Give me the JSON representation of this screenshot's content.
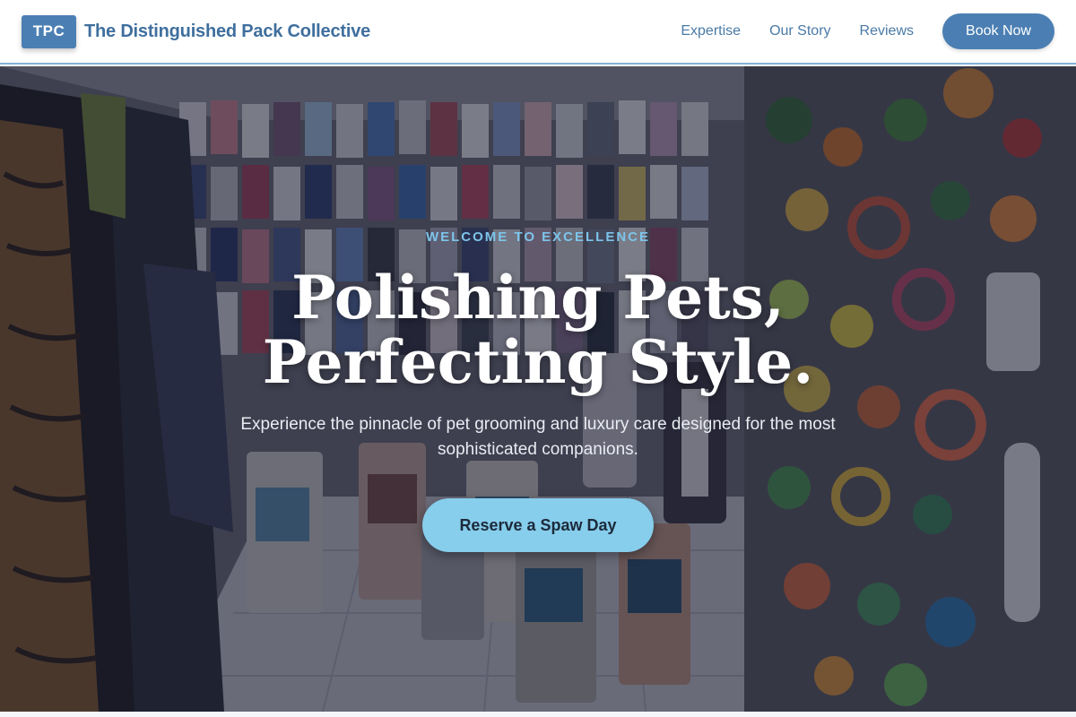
{
  "header": {
    "logo_badge": "TPC",
    "brand_name": "The Distinguished Pack Collective",
    "nav": [
      {
        "label": "Expertise"
      },
      {
        "label": "Our Story"
      },
      {
        "label": "Reviews"
      }
    ],
    "book_button": "Book Now"
  },
  "hero": {
    "eyebrow": "WELCOME TO EXCELLENCE",
    "headline": "Polishing Pets, Perfecting Style.",
    "subheadline": "Experience the pinnacle of pet grooming and luxury care designed for the most sophisticated companions.",
    "cta": "Reserve a Spaw Day",
    "background_image": "pet-boutique-interior-photo"
  },
  "colors": {
    "primary": "#4b7fb3",
    "brand_text": "#3f6f9e",
    "accent": "#87cdec",
    "eyebrow": "#7dc4ea",
    "header_border": "#7fb0d8"
  }
}
